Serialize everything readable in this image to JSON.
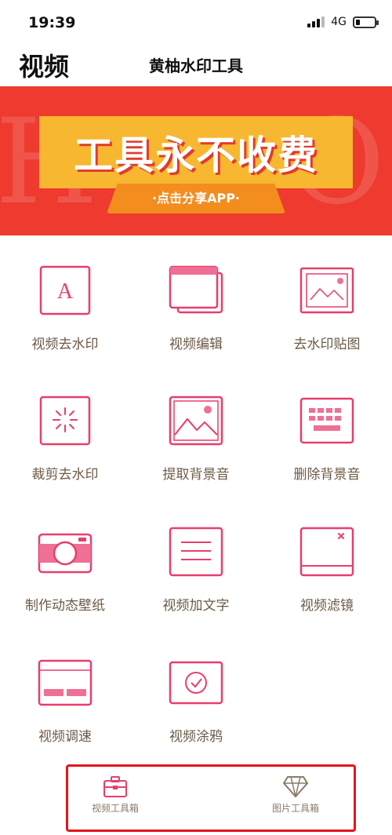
{
  "status": {
    "time": "19:39",
    "network": "4G",
    "battery_level": 0.2
  },
  "header": {
    "section": "视频",
    "title": "黄柚水印工具"
  },
  "banner": {
    "bg_text": "HYDO",
    "headline": "工具永不收费",
    "button": "·点击分享APP·"
  },
  "tools": [
    {
      "label": "视频去水印",
      "icon": "letter-a-icon"
    },
    {
      "label": "视频编辑",
      "icon": "stacked-cards-icon"
    },
    {
      "label": "去水印贴图",
      "icon": "image-frame-icon"
    },
    {
      "label": "裁剪去水印",
      "icon": "sparkle-icon"
    },
    {
      "label": "提取背景音",
      "icon": "landscape-icon"
    },
    {
      "label": "删除背景音",
      "icon": "keyboard-icon"
    },
    {
      "label": "制作动态壁纸",
      "icon": "camera-icon"
    },
    {
      "label": "视频加文字",
      "icon": "text-lines-icon"
    },
    {
      "label": "视频滤镜",
      "icon": "window-close-icon"
    },
    {
      "label": "视频调速",
      "icon": "speed-panel-icon"
    },
    {
      "label": "视频涂鸦",
      "icon": "check-circle-icon"
    }
  ],
  "tabs": [
    {
      "label": "视频工具箱",
      "icon": "toolbox-icon"
    },
    {
      "label": "图片工具箱",
      "icon": "diamond-icon"
    }
  ],
  "colors": {
    "accent": "#e83e6c",
    "banner_red": "#ee3a2f",
    "banner_yellow": "#f7b731",
    "label": "#6b5a46"
  }
}
